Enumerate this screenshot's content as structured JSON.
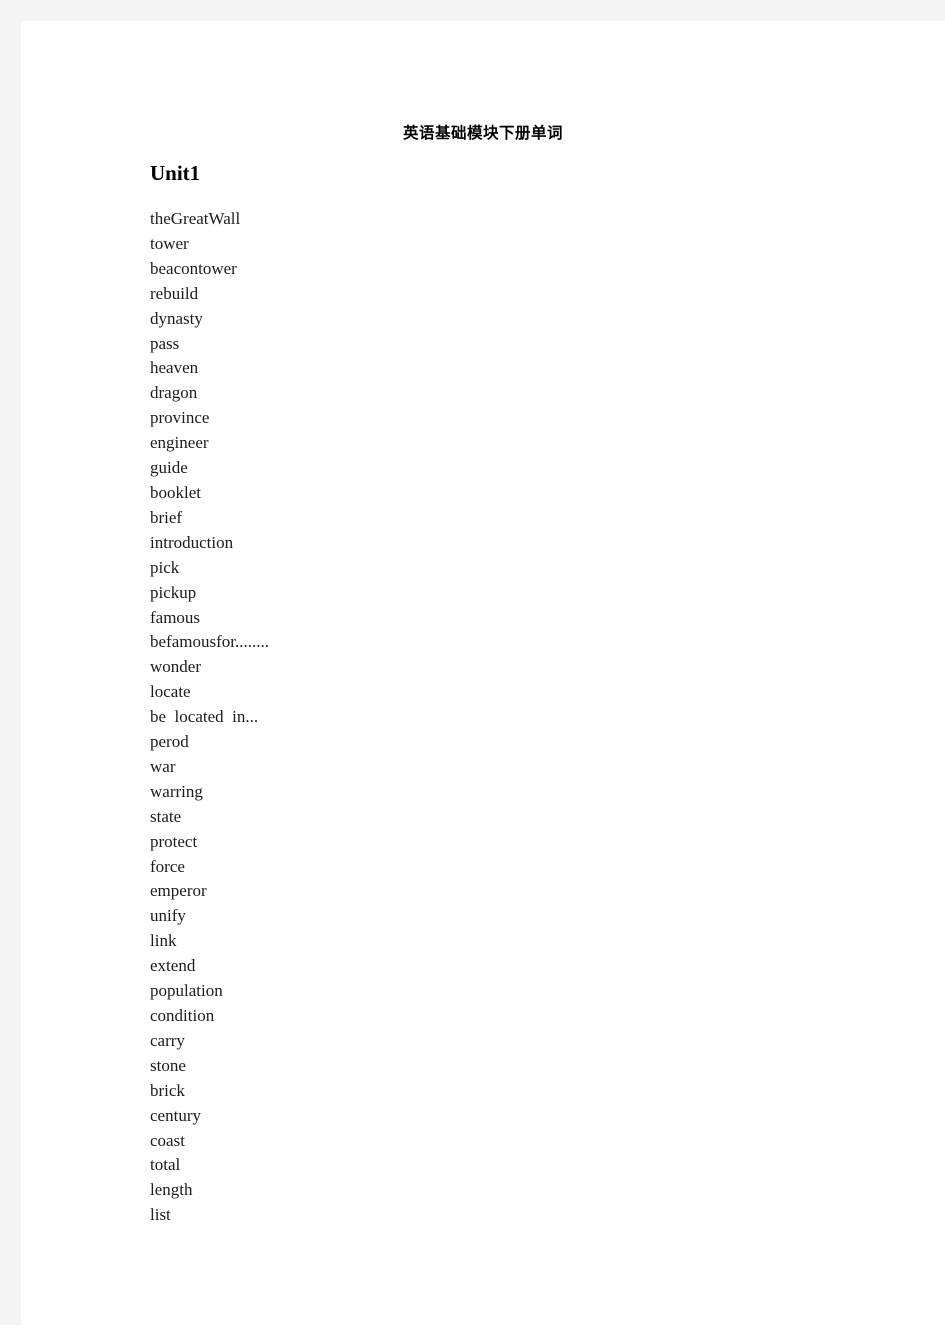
{
  "document": {
    "title": "英语基础模块下册单词",
    "unit_heading": "Unit1",
    "words": [
      "theGreatWall",
      "tower",
      "beacontower",
      "rebuild",
      "dynasty",
      "pass",
      "heaven",
      "dragon",
      "province",
      "engineer",
      "guide",
      "booklet",
      "brief",
      "introduction",
      "pick",
      "pickup",
      "famous",
      "befamousfor........",
      "wonder",
      "locate",
      "be  located  in...",
      "perod",
      "war",
      "warring",
      "state",
      "protect",
      "force",
      "emperor",
      "unify",
      "link",
      "extend",
      "population",
      "condition",
      "carry",
      "stone",
      "brick",
      "century",
      "coast",
      "total",
      "length",
      "list"
    ]
  },
  "colors": {
    "page_background": "#ffffff",
    "gutter": "#f4f4f5",
    "text": "#1c1c1c",
    "heading": "#000000"
  }
}
